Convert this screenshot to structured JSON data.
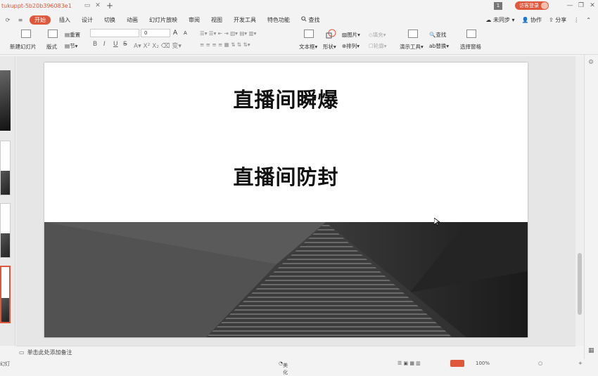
{
  "titlebar": {
    "doc_title": "tukuppt-5b20b396083e1",
    "page_indicator": "1",
    "login_label": "访客登录",
    "minimize": "—",
    "restore": "❐",
    "close": "✕",
    "tab_close": "✕",
    "tab_window": "▭",
    "new_tab": "+"
  },
  "menubar": {
    "quick_icons": [
      "⟳",
      "≡"
    ],
    "items": [
      "开始",
      "插入",
      "设计",
      "切换",
      "动画",
      "幻灯片放映",
      "审阅",
      "视图",
      "开发工具",
      "特色功能",
      "查找"
    ],
    "active_index": 0,
    "search_icon": "search-icon",
    "right": {
      "sync": "未同步",
      "collab": "协作",
      "share": "分享",
      "more": "⋮",
      "collapse": "⌃"
    }
  },
  "ribbon": {
    "new_slide": "新建幻灯片",
    "layout": "版式",
    "reset": "重置",
    "section": "节",
    "font_size": "0",
    "grow_font": "A",
    "shrink_font": "A",
    "bold": "B",
    "italic": "I",
    "underline": "U",
    "strike": "S",
    "text_box": "文本框",
    "shape": "形状",
    "picture": "图片",
    "fill": "填充",
    "arrange": "排列",
    "outline": "轮廓",
    "presentation_tools": "演示工具",
    "find": "查找",
    "replace": "替换",
    "selection_pane": "选择窗格"
  },
  "slide": {
    "title1": "直播间瞬爆",
    "title2": "直播间防封"
  },
  "notes": {
    "placeholder": "单击此处添加备注"
  },
  "statusbar": {
    "left": "幻灯",
    "beautify": "美化",
    "zoom": "100%"
  },
  "colors": {
    "accent": "#e0583c"
  }
}
